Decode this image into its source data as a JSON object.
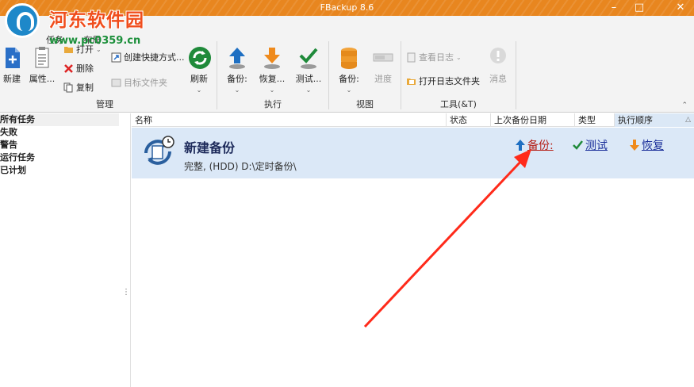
{
  "window": {
    "title": "FBackup 8.6"
  },
  "watermark": {
    "site_name": "河东软件园",
    "url": "www.pc0359.cn"
  },
  "menu": {
    "tabs": [
      "任务",
      "布局"
    ]
  },
  "ribbon": {
    "groups": [
      {
        "label": "管理"
      },
      {
        "label": "执行"
      },
      {
        "label": "视图"
      },
      {
        "label": "工具(&T)"
      }
    ],
    "buttons": {
      "new": "新建",
      "properties": "属性...",
      "open": "打开",
      "delete": "删除",
      "copy": "复制",
      "create_shortcut": "创建快捷方式...",
      "target_folder": "目标文件夹",
      "refresh": "刷新",
      "backup": "备份:",
      "restore": "恢复...",
      "test": "测试...",
      "view_backup": "备份:",
      "progress": "进度",
      "view_log": "查看日志",
      "open_log_folder": "打开日志文件夹",
      "messages": "消息"
    }
  },
  "sidebar": {
    "items": [
      {
        "label": "所有任务",
        "selected": true
      },
      {
        "label": "失败"
      },
      {
        "label": "警告"
      },
      {
        "label": "运行任务"
      },
      {
        "label": "已计划"
      }
    ]
  },
  "list": {
    "columns": [
      "名称",
      "状态",
      "上次备份日期",
      "类型",
      "执行顺序"
    ],
    "sort_indicator": "△",
    "task": {
      "name": "新建备份",
      "description": "完整, (HDD) D:\\定时备份\\",
      "actions": {
        "backup": "备份:",
        "test": "测试",
        "restore": "恢复"
      }
    }
  },
  "colors": {
    "titlebar": "#e8861f",
    "selection": "#dbe8f7",
    "annotation_arrow": "#ff2a1a"
  }
}
